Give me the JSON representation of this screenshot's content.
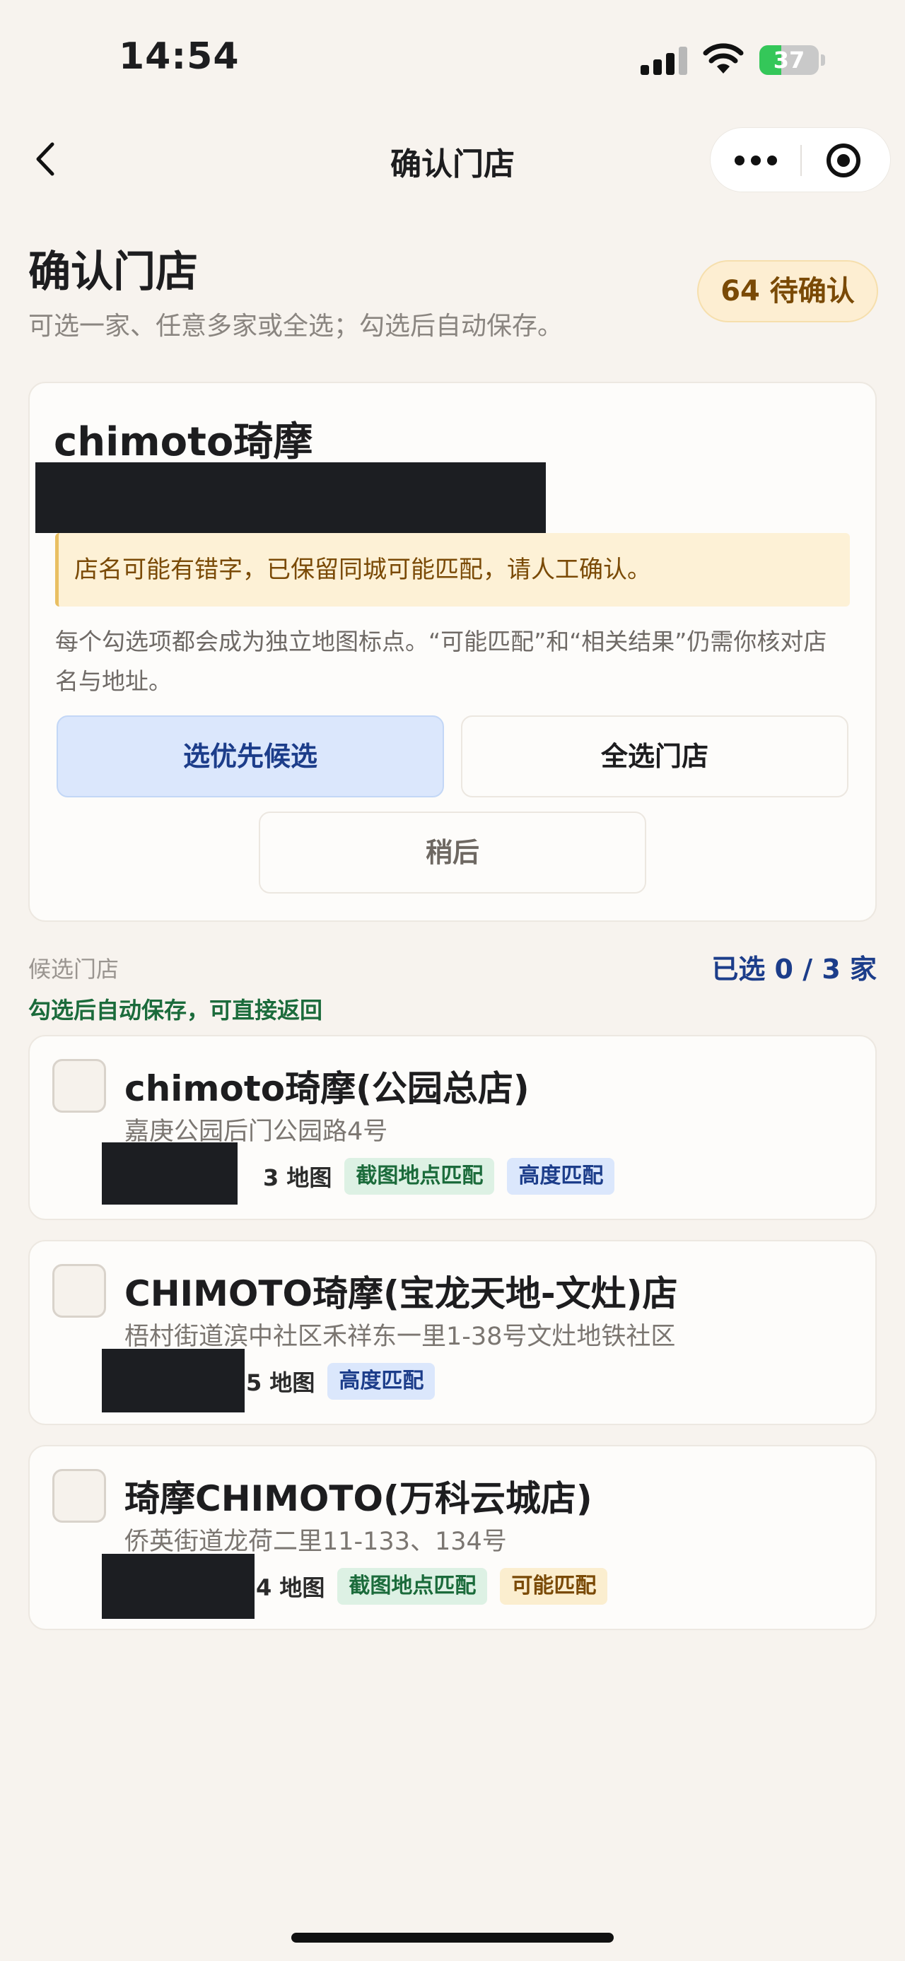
{
  "status_bar": {
    "time": "14:54",
    "battery": "37",
    "battery_level": 0.37
  },
  "nav": {
    "title": "确认门店"
  },
  "header": {
    "title": "确认门店",
    "subtitle": "可选一家、任意多家或全选；勾选后自动保存。",
    "pending_badge": "64 待确认"
  },
  "store": {
    "name": "chimoto琦摩",
    "warning": "店名可能有错字，已保留同城可能匹配，请人工确认。",
    "info": "每个勾选项都会成为独立地图标点。“可能匹配”和“相关结果”仍需你核对店名与地址。",
    "buttons": {
      "select_priority": "选优先候选",
      "select_all": "全选门店",
      "later": "稍后"
    }
  },
  "candidates": {
    "label": "候选门店",
    "count": "已选 0 / 3 家",
    "hint": "勾选后自动保存，可直接返回",
    "items": [
      {
        "name": "chimoto琦摩(公园总店)",
        "address": "嘉庚公园后门公园路4号",
        "map_text": "3 地图",
        "tags": [
          "截图地点匹配",
          "高度匹配"
        ]
      },
      {
        "name": "CHIMOTO琦摩(宝龙天地-文灶)店",
        "address": "梧村街道滨中社区禾祥东一里1-38号文灶地铁社区",
        "map_text": "5 地图",
        "tags": [
          "高度匹配"
        ]
      },
      {
        "name": "琦摩CHIMOTO(万科云城店)",
        "address": "侨英街道龙荷二里11-133、134号",
        "map_text": "4 地图",
        "tags": [
          "截图地点匹配",
          "可能匹配"
        ]
      }
    ]
  },
  "colors": {
    "accent_blue": "#1c3d8a",
    "accent_green": "#1b6b3b",
    "warning": "#7a4a06",
    "background": "#f7f3ee"
  }
}
